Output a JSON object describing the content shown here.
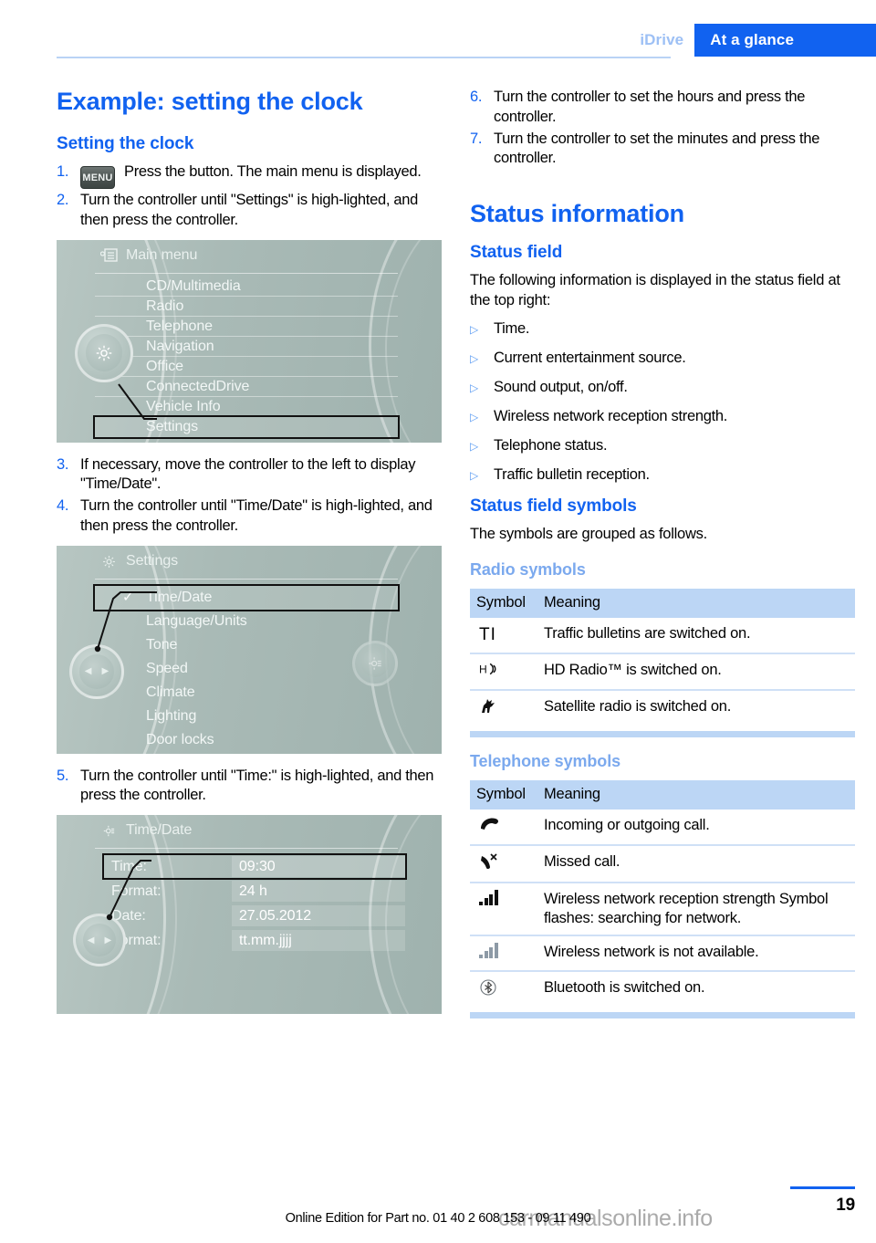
{
  "header": {
    "chapter": "iDrive",
    "section": "At a glance"
  },
  "left_column": {
    "chapter_title": "Example: setting the clock",
    "sub_title": "Setting the clock",
    "steps": [
      {
        "num": "1.",
        "icon_label": "MENU",
        "text": "Press the button. The main menu is displayed."
      },
      {
        "num": "2.",
        "text": "Turn the controller until \"Settings\" is high-lighted, and then press the controller."
      },
      {
        "num": "3.",
        "text": "If necessary, move the controller to the left to display \"Time/Date\"."
      },
      {
        "num": "4.",
        "text": "Turn the controller until \"Time/Date\" is high-lighted, and then press the controller."
      },
      {
        "num": "5.",
        "text": "Turn the controller until \"Time:\" is high-lighted, and then press the controller."
      }
    ],
    "screen_main_menu": {
      "title": "Main menu",
      "header_icon": "list-icon",
      "knob_icon": "gear-icon",
      "items": [
        {
          "label": "CD/Multimedia",
          "selected": false
        },
        {
          "label": "Radio",
          "selected": false
        },
        {
          "label": "Telephone",
          "selected": false
        },
        {
          "label": "Navigation",
          "selected": false
        },
        {
          "label": "Office",
          "selected": false
        },
        {
          "label": "ConnectedDrive",
          "selected": false
        },
        {
          "label": "Vehicle Info",
          "selected": false
        },
        {
          "label": "Settings",
          "selected": true
        }
      ]
    },
    "screen_settings": {
      "title": "Settings",
      "header_icon": "gear-icon",
      "knob_icon": "left-right-arrows-icon",
      "knob_right_icon": "settings-gear-icon",
      "items": [
        {
          "label": "Time/Date",
          "selected": true,
          "check": "✓"
        },
        {
          "label": "Language/Units",
          "selected": false
        },
        {
          "label": "Tone",
          "selected": false
        },
        {
          "label": "Speed",
          "selected": false
        },
        {
          "label": "Climate",
          "selected": false
        },
        {
          "label": "Lighting",
          "selected": false
        },
        {
          "label": "Door locks",
          "selected": false
        }
      ]
    },
    "screen_time_date": {
      "title": "Time/Date",
      "header_icon": "gear-icon",
      "knob_icon": "left-right-arrows-icon",
      "rows": [
        {
          "label": "Time:",
          "value": "09:30",
          "selected": true
        },
        {
          "label": "Format:",
          "value": "24 h",
          "selected": false
        },
        {
          "label": "Date:",
          "value": "27.05.2012",
          "selected": false
        },
        {
          "label": "Format:",
          "value": "tt.mm.jjjj",
          "selected": false
        }
      ]
    }
  },
  "right_column": {
    "steps": [
      {
        "num": "6.",
        "text": "Turn the controller to set the hours and press the controller."
      },
      {
        "num": "7.",
        "text": "Turn the controller to set the minutes and press the controller."
      }
    ],
    "chapter_title": "Status information",
    "status_field": {
      "sub_title": "Status field",
      "intro": "The following information is displayed in the status field at the top right:",
      "items": [
        "Time.",
        "Current entertainment source.",
        "Sound output, on/off.",
        "Wireless network reception strength.",
        "Telephone status.",
        "Traffic bulletin reception."
      ]
    },
    "status_field_symbols": {
      "sub_title": "Status field symbols",
      "intro": "The symbols are grouped as follows."
    },
    "radio_symbols": {
      "title": "Radio symbols",
      "columns": [
        "Symbol",
        "Meaning"
      ],
      "rows": [
        {
          "symbol": "TI",
          "symbol_name": "traffic-info-icon",
          "meaning": "Traffic bulletins are switched on."
        },
        {
          "symbol": "HD))",
          "symbol_name": "hd-radio-icon",
          "meaning": "HD Radio™ is switched on."
        },
        {
          "symbol": "▰",
          "symbol_name": "satellite-radio-icon",
          "meaning": "Satellite radio is switched on."
        }
      ]
    },
    "telephone_symbols": {
      "title": "Telephone symbols",
      "columns": [
        "Symbol",
        "Meaning"
      ],
      "rows": [
        {
          "symbol": "✆",
          "symbol_name": "phone-handset-icon",
          "meaning": "Incoming or outgoing call."
        },
        {
          "symbol": "✆",
          "symbol_name": "missed-call-icon",
          "meaning": "Missed call."
        },
        {
          "symbol": "bars",
          "symbol_name": "signal-bars-icon",
          "meaning": "Wireless network reception strength Symbol flashes: searching for network."
        },
        {
          "symbol": "bars-dim",
          "symbol_name": "signal-bars-unavailable-icon",
          "meaning": "Wireless network is not available."
        },
        {
          "symbol": "Ⓑ",
          "symbol_name": "bluetooth-icon",
          "meaning": "Bluetooth is switched on."
        }
      ]
    }
  },
  "footer": {
    "text": "Online Edition for Part no. 01 40 2 608 153 - 09 11 490",
    "page_number": "19",
    "watermark": "carmanualsonline.info"
  },
  "colors": {
    "accent_blue": "#1162f0",
    "light_blue": "#7ba9ee",
    "table_header": "#bcd6f5",
    "table_rule": "#cfe0f6"
  }
}
